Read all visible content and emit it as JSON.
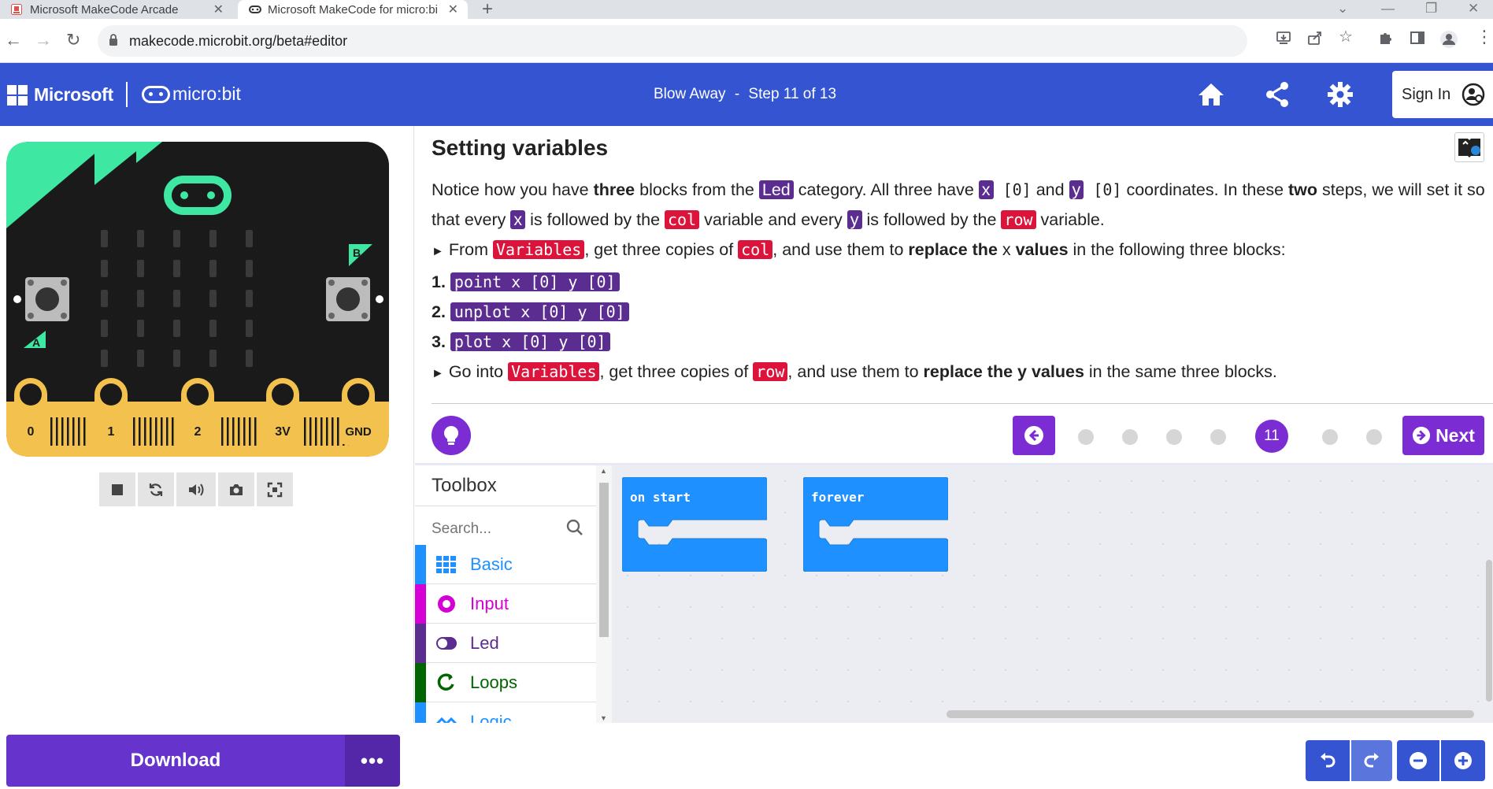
{
  "browser": {
    "tabs": [
      {
        "title": "Microsoft MakeCode Arcade",
        "active": false
      },
      {
        "title": "Microsoft MakeCode for micro:bi",
        "active": true
      }
    ],
    "new_tab": "+",
    "url": "makecode.microbit.org/beta#editor",
    "window_controls": [
      "⌄",
      "—",
      "❐",
      "✕"
    ]
  },
  "header": {
    "brand": "Microsoft",
    "product": "micro:bit",
    "tutorial_title": "Blow Away",
    "step_sep": "-",
    "step_label": "Step 11 of 13",
    "icons": [
      "home-icon",
      "share-icon",
      "settings-icon"
    ],
    "sign_in": "Sign In"
  },
  "simulator": {
    "pins": [
      "0",
      "1",
      "2",
      "3V",
      "GND"
    ],
    "button_a": "A",
    "button_b": "B",
    "controls": [
      "stop-icon",
      "restart-icon",
      "sound-icon",
      "screenshot-icon",
      "fullscreen-icon"
    ]
  },
  "tutorial": {
    "title": "Setting variables",
    "p1": {
      "t1": "Notice how you have ",
      "b1": "three",
      "t2": " blocks from the ",
      "cat": "Led",
      "t3": " category. All three have ",
      "x": "x",
      "xv": " [0]",
      "t4": " and ",
      "y": "y",
      "yv": " [0]",
      "t5": " coordinates. In these ",
      "b2": "two",
      "t6": " steps, we will set it so that every ",
      "x2": "x",
      "t7": " is followed by the ",
      "col": "col",
      "t8": " variable and every ",
      "y2": "y",
      "t9": " is followed by the ",
      "row": "row",
      "t10": " variable."
    },
    "bullet1": {
      "arrow": "►",
      "t1": " From ",
      "cat": "Variables",
      "t2": ", get three copies of ",
      "var": "col",
      "t3": ", and use them to ",
      "b1": "replace the ",
      "mid": "x",
      "b2": " values",
      "t4": " in the following three blocks:"
    },
    "list": [
      {
        "num": "1.",
        "code": "point x [0] y [0]"
      },
      {
        "num": "2.",
        "code": "unplot x [0] y [0]"
      },
      {
        "num": "3.",
        "code": "plot x [0] y [0]"
      }
    ],
    "bullet2": {
      "arrow": "►",
      "t1": " Go into ",
      "cat": "Variables",
      "t2": ", get three copies of ",
      "var": "row",
      "t3": ", and use them to ",
      "b1": "replace the y values",
      "t4": " in the same three blocks."
    },
    "current_step": "11",
    "next_label": "Next",
    "step_dots_before": 4,
    "step_dots_after": 2
  },
  "toolbox": {
    "title": "Toolbox",
    "search_placeholder": "Search...",
    "categories": [
      {
        "label": "Basic",
        "color": "#1e90ff",
        "icon": "grid-icon"
      },
      {
        "label": "Input",
        "color": "#d400d4",
        "icon": "input-icon"
      },
      {
        "label": "Led",
        "color": "#5c2d91",
        "icon": "toggle-icon"
      },
      {
        "label": "Loops",
        "color": "#00aa00",
        "icon": "loop-icon"
      },
      {
        "label": "Logic",
        "color": "#00a4a6",
        "icon": "logic-icon"
      }
    ]
  },
  "workspace": {
    "blocks": [
      {
        "label": "on start",
        "color": "#1e90ff"
      },
      {
        "label": "forever",
        "color": "#1e90ff"
      }
    ]
  },
  "bottom": {
    "download": "Download",
    "more": "•••",
    "icons": [
      "undo-icon",
      "redo-icon",
      "zoom-out-icon",
      "zoom-in-icon"
    ]
  },
  "colors": {
    "header_blue": "#3454d1",
    "tutorial_purple": "#7b2cd3",
    "led_purple": "#5c2d91",
    "variables_red": "#dc143c",
    "download_purple": "#6633cc",
    "board_black": "#1a1a1a",
    "board_green": "#3ee8a2",
    "board_gold": "#f2c14e"
  }
}
